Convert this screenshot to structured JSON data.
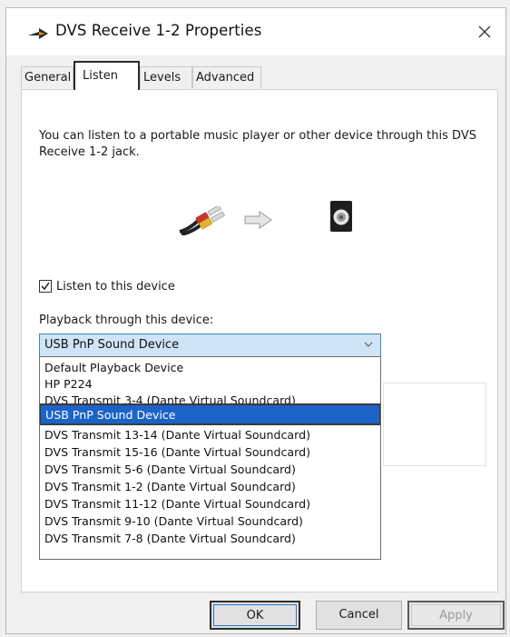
{
  "window": {
    "title": "DVS Receive  1-2 Properties",
    "icon": "speaker-arrow-icon",
    "close": "close-icon"
  },
  "tabs": [
    {
      "label": "General",
      "active": false
    },
    {
      "label": "Listen",
      "active": true
    },
    {
      "label": "Levels",
      "active": false
    },
    {
      "label": "Advanced",
      "active": false
    }
  ],
  "listen": {
    "description": "You can listen to a portable music player or other device through this DVS Receive  1-2 jack.",
    "checkbox_label": "Listen to this device",
    "checkbox_checked": true,
    "playback_label": "Playback through this device:",
    "selected_device": "USB PnP Sound Device",
    "options": [
      "Default Playback Device",
      "HP P224",
      "DVS Transmit  3-4 (Dante Virtual Soundcard)",
      "USB PnP Sound Device",
      "DVS Transmit 13-14 (Dante Virtual Soundcard)",
      "DVS Transmit 15-16 (Dante Virtual Soundcard)",
      "DVS Transmit  5-6 (Dante Virtual Soundcard)",
      "DVS Transmit  1-2 (Dante Virtual Soundcard)",
      "DVS Transmit 11-12 (Dante Virtual Soundcard)",
      "DVS Transmit  9-10 (Dante Virtual Soundcard)",
      "DVS Transmit  7-8 (Dante Virtual Soundcard)"
    ],
    "selected_index": 3
  },
  "buttons": {
    "ok": "OK",
    "cancel": "Cancel",
    "apply": "Apply"
  },
  "colors": {
    "selection": "#1c63c8",
    "combo_bg": "#cfe4f6",
    "combo_border": "#3d86c6"
  }
}
